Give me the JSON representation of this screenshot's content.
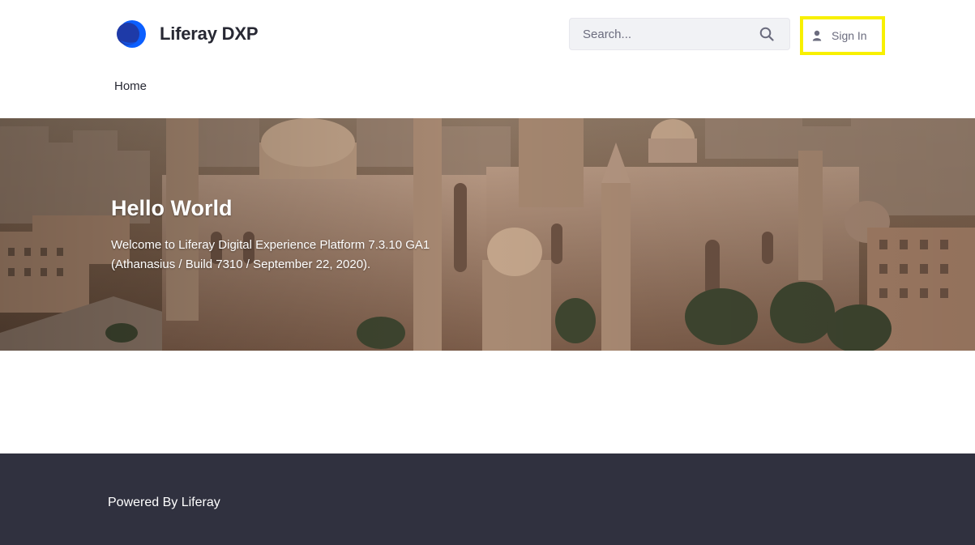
{
  "brand": {
    "name": "Liferay DXP",
    "logo_colors": {
      "primary": "#0b5fff",
      "secondary": "#1e3aa8"
    }
  },
  "search": {
    "placeholder": "Search...",
    "icon": "search-icon"
  },
  "account": {
    "sign_in_label": "Sign In",
    "icon": "user-icon",
    "highlight_color": "#f8f000"
  },
  "navigation": {
    "items": [
      {
        "label": "Home"
      }
    ]
  },
  "hero": {
    "title": "Hello World",
    "description_line1": "Welcome to Liferay Digital Experience Platform 7.3.10 GA1",
    "description_line2": "(Athanasius / Build 7310 / September 22, 2020).",
    "background": "cityscape-with-mosques-image"
  },
  "footer": {
    "text": "Powered By Liferay",
    "background_color": "#30313f"
  }
}
